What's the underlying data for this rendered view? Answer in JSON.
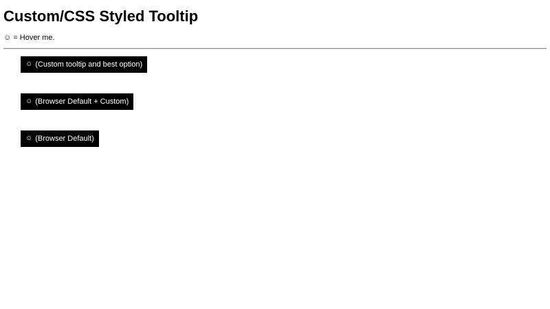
{
  "page": {
    "title": "Custom/CSS Styled Tooltip",
    "hint": {
      "icon": "☺",
      "text": "= Hover me."
    }
  },
  "buttons": [
    {
      "icon": "☺",
      "label": "(Custom tooltip and best option)"
    },
    {
      "icon": "☺",
      "label": "(Browser Default + Custom)"
    },
    {
      "icon": "☺",
      "label": "(Browser Default)"
    }
  ],
  "colors": {
    "button_bg": "#000000",
    "button_text": "#ffffff",
    "divider": "#8a8a8a"
  }
}
